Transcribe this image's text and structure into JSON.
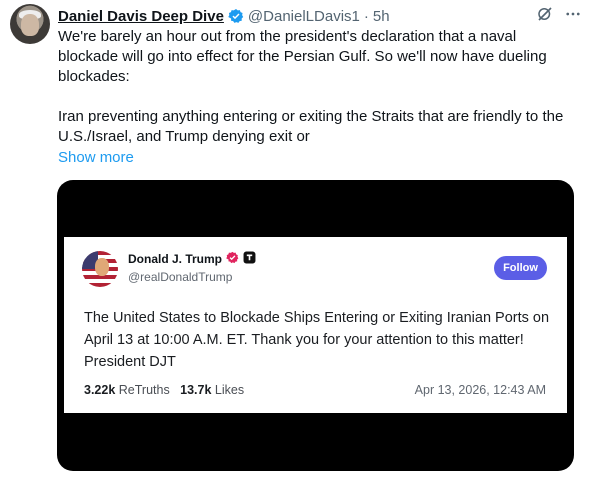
{
  "post": {
    "author_name": "Daniel Davis Deep Dive",
    "author_handle": "@DanielLDavis1",
    "separator": "·",
    "time": "5h",
    "text": "We're barely an hour out from the president's declaration that a naval blockade will go into effect for the Persian Gulf. So we'll now have dueling blockades:\n\nIran preventing anything entering or exiting the Straits that are friendly to the U.S./Israel, and Trump denying exit or",
    "show_more_label": "Show more",
    "icons": [
      "verified-badge-icon",
      "grok-icon",
      "more-options-icon"
    ]
  },
  "embedded": {
    "name": "Donald J. Trump",
    "handle": "@realDonaldTrump",
    "follow_label": "Follow",
    "text": "The United States to Blockade Ships Entering or Exiting Iranian Ports on April 13 at 10:00 A.M. ET. Thank you for your attention to this matter! President DJT",
    "retruths_count": "3.22k",
    "retruths_label": "ReTruths",
    "likes_count": "13.7k",
    "likes_label": "Likes",
    "date": "Apr 13, 2026, 12:43 AM",
    "icons": [
      "verified-badge-icon",
      "truth-social-icon"
    ]
  },
  "colors": {
    "link": "#1d9bf0",
    "verified": "#1d9bf0",
    "follow_button": "#5b5ee6",
    "embedded_verified": "#e0245e",
    "media_background": "#000000"
  }
}
